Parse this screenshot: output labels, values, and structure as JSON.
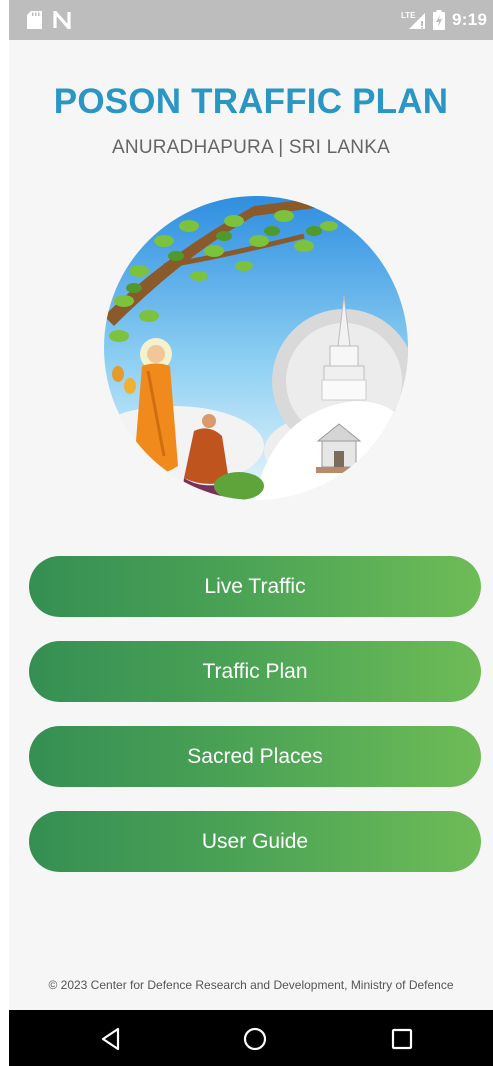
{
  "status_bar": {
    "time": "9:19",
    "network_label": "LTE",
    "icons": [
      "sd-card-icon",
      "n-notification-icon",
      "lte-signal-icon",
      "battery-charging-icon"
    ]
  },
  "header": {
    "title": "POSON TRAFFIC PLAN",
    "subtitle": "ANURADHAPURA | SRI LANKA"
  },
  "hero": {
    "icon": "buddha-and-stupa-illustration"
  },
  "menu": {
    "items": [
      {
        "label": "Live Traffic"
      },
      {
        "label": "Traffic Plan"
      },
      {
        "label": "Sacred Places"
      },
      {
        "label": "User Guide"
      }
    ]
  },
  "footer": {
    "copyright": "© 2023 Center for Defence Research and Development, Ministry of Defence"
  },
  "nav_bar": {
    "icons": [
      "back-icon",
      "home-icon",
      "recents-icon"
    ]
  },
  "colors": {
    "title": "#2a96c4",
    "subtitle": "#666666",
    "button_start": "#358f53",
    "button_end": "#6ebc57",
    "status_bar": "#bdbdbd",
    "nav_bar": "#000000",
    "background": "#f6f6f6"
  }
}
